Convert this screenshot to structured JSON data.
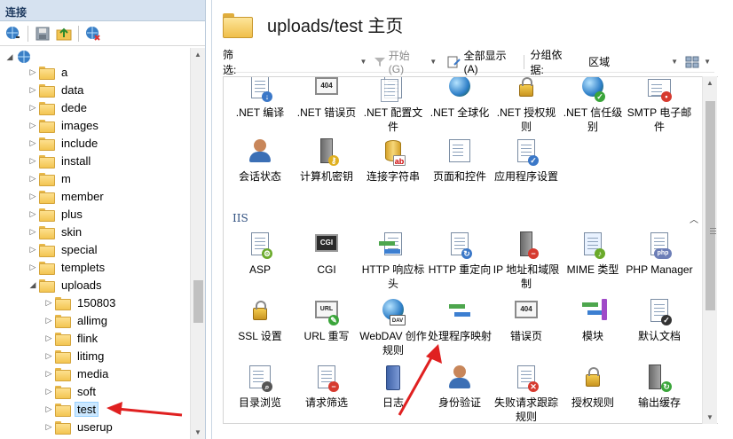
{
  "left_panel": {
    "header": "连接",
    "toolbar_icons": [
      "globe-connect-icon",
      "save-icon",
      "up-folder-icon",
      "disconnect-icon"
    ],
    "tree": {
      "root_label": "",
      "items": [
        {
          "label": "a",
          "expanded": false
        },
        {
          "label": "data",
          "expanded": false
        },
        {
          "label": "dede",
          "expanded": false
        },
        {
          "label": "images",
          "expanded": false
        },
        {
          "label": "include",
          "expanded": false
        },
        {
          "label": "install",
          "expanded": false
        },
        {
          "label": "m",
          "expanded": false
        },
        {
          "label": "member",
          "expanded": false
        },
        {
          "label": "plus",
          "expanded": false
        },
        {
          "label": "skin",
          "expanded": false
        },
        {
          "label": "special",
          "expanded": false
        },
        {
          "label": "templets",
          "expanded": false
        },
        {
          "label": "uploads",
          "expanded": true
        },
        {
          "label": "150803",
          "expanded": false
        },
        {
          "label": "allimg",
          "expanded": false
        },
        {
          "label": "flink",
          "expanded": false
        },
        {
          "label": "litimg",
          "expanded": false
        },
        {
          "label": "media",
          "expanded": false
        },
        {
          "label": "soft",
          "expanded": false
        },
        {
          "label": "test",
          "expanded": false,
          "selected": true
        },
        {
          "label": "userup",
          "expanded": false
        }
      ]
    }
  },
  "main": {
    "title": "uploads/test 主页",
    "filter_bar": {
      "filter_label": "筛选:",
      "filter_value": "",
      "go_label": "开始(G)",
      "show_all_label": "全部显示(A)",
      "group_by_label": "分组依据:",
      "group_by_value": "区域"
    },
    "aspnet_features": [
      {
        "label": ".NET 编译",
        "icon": "compile-icon"
      },
      {
        "label": ".NET 错误页",
        "icon": "error-404-icon"
      },
      {
        "label": ".NET 配置文件",
        "icon": "profile-icon"
      },
      {
        "label": ".NET 全球化",
        "icon": "globe-icon"
      },
      {
        "label": ".NET 授权规则",
        "icon": "lock-icon"
      },
      {
        "label": ".NET 信任级别",
        "icon": "trust-level-icon"
      },
      {
        "label": "SMTP 电子邮件",
        "icon": "smtp-email-icon"
      },
      {
        "label": "会话状态",
        "icon": "session-state-icon"
      },
      {
        "label": "计算机密钥",
        "icon": "machine-key-icon"
      },
      {
        "label": "连接字符串",
        "icon": "connection-string-icon"
      },
      {
        "label": "页面和控件",
        "icon": "pages-controls-icon"
      },
      {
        "label": "应用程序设置",
        "icon": "app-settings-icon"
      }
    ],
    "iis_section": {
      "title": "IIS",
      "features": [
        {
          "label": "ASP",
          "icon": "asp-icon"
        },
        {
          "label": "CGI",
          "icon": "cgi-icon"
        },
        {
          "label": "HTTP 响应标头",
          "icon": "http-headers-icon"
        },
        {
          "label": "HTTP 重定向",
          "icon": "http-redirect-icon"
        },
        {
          "label": "IP 地址和域限制",
          "icon": "ip-restrictions-icon"
        },
        {
          "label": "MIME 类型",
          "icon": "mime-types-icon"
        },
        {
          "label": "PHP Manager",
          "icon": "php-icon"
        },
        {
          "label": "SSL 设置",
          "icon": "ssl-lock-icon"
        },
        {
          "label": "URL 重写",
          "icon": "url-rewrite-icon"
        },
        {
          "label": "WebDAV 创作规则",
          "icon": "webdav-icon"
        },
        {
          "label": "处理程序映射",
          "icon": "handler-mappings-icon"
        },
        {
          "label": "错误页",
          "icon": "error-pages-icon"
        },
        {
          "label": "模块",
          "icon": "modules-icon"
        },
        {
          "label": "默认文档",
          "icon": "default-document-icon"
        },
        {
          "label": "目录浏览",
          "icon": "directory-browsing-icon"
        },
        {
          "label": "请求筛选",
          "icon": "request-filtering-icon"
        },
        {
          "label": "日志",
          "icon": "logging-icon"
        },
        {
          "label": "身份验证",
          "icon": "authentication-icon"
        },
        {
          "label": "失败请求跟踪规则",
          "icon": "failed-request-tracing-icon"
        },
        {
          "label": "授权规则",
          "icon": "authorization-icon"
        },
        {
          "label": "输出缓存",
          "icon": "output-caching-icon"
        }
      ]
    }
  },
  "colors": {
    "header_bg": "#d6e2f0",
    "selection_bg": "#cce8ff",
    "annotation_red": "#e02020",
    "section_title": "#2f4f7f"
  }
}
